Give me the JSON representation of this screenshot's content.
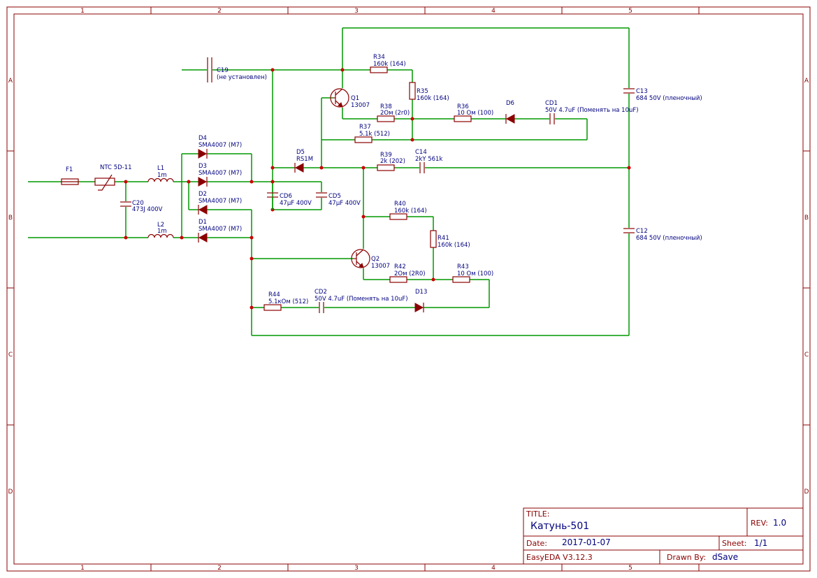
{
  "frame": {
    "columns": [
      "1",
      "2",
      "3",
      "4",
      "5"
    ],
    "rows": [
      "A",
      "B",
      "C",
      "D"
    ]
  },
  "title_block": {
    "title_label": "TITLE:",
    "title": "Катунь-501",
    "rev_label": "REV:",
    "rev": "1.0",
    "date_label": "Date:",
    "date": "2017-01-07",
    "sheet_label": "Sheet:",
    "sheet": "1/1",
    "software": "EasyEDA V3.12.3",
    "drawn_label": "Drawn By:",
    "drawn_by": "dSave"
  },
  "components": {
    "F1": {
      "ref": "F1",
      "value": ""
    },
    "NTC": {
      "ref": "NTC 5D-11",
      "value": ""
    },
    "L1": {
      "ref": "L1",
      "value": "1m"
    },
    "L2": {
      "ref": "L2",
      "value": "1m"
    },
    "C20": {
      "ref": "C20",
      "value": "473J 400V"
    },
    "D4": {
      "ref": "D4",
      "value": "SMA4007 (M7)"
    },
    "D3": {
      "ref": "D3",
      "value": "SMA4007 (M7)"
    },
    "D2": {
      "ref": "D2",
      "value": "SMA4007 (M7)"
    },
    "D1": {
      "ref": "D1",
      "value": "SMA4007 (M7)"
    },
    "CD6": {
      "ref": "CD6",
      "value": "47µF 400V"
    },
    "CD5": {
      "ref": "CD5",
      "value": "47µF 400V"
    },
    "C19": {
      "ref": "C19",
      "value": "(не установлен)"
    },
    "D5": {
      "ref": "D5",
      "value": "RS1M"
    },
    "Q1": {
      "ref": "Q1",
      "value": "13007"
    },
    "Q2": {
      "ref": "Q2",
      "value": "13007"
    },
    "R34": {
      "ref": "R34",
      "value": "160k (164)"
    },
    "R35": {
      "ref": "R35",
      "value": "160k (164)"
    },
    "R38": {
      "ref": "R38",
      "value": "2Ом (2r0)"
    },
    "R36": {
      "ref": "R36",
      "value": "10 Ом (100)"
    },
    "D6": {
      "ref": "D6",
      "value": ""
    },
    "CD1": {
      "ref": "CD1",
      "value": "50V 4.7uF (Поменять на 10uF)"
    },
    "R37": {
      "ref": "R37",
      "value": "5.1k (512)"
    },
    "R39": {
      "ref": "R39",
      "value": "2k (202)"
    },
    "C14": {
      "ref": "C14",
      "value": "2kY 561k"
    },
    "C13": {
      "ref": "C13",
      "value": "684 50V (пленочный)"
    },
    "C12": {
      "ref": "C12",
      "value": "684 50V (пленочный)"
    },
    "R40": {
      "ref": "R40",
      "value": "160k (164)"
    },
    "R41": {
      "ref": "R41",
      "value": "160k (164)"
    },
    "R42": {
      "ref": "R42",
      "value": "2Ом (2R0)"
    },
    "R43": {
      "ref": "R43",
      "value": "10 Ом (100)"
    },
    "R44": {
      "ref": "R44",
      "value": "5.1кОм (512)"
    },
    "CD2": {
      "ref": "CD2",
      "value": "50V 4.7uF (Поменять на 10uF)"
    },
    "D13": {
      "ref": "D13",
      "value": ""
    }
  },
  "colors": {
    "wire": "#009900",
    "symbol": "#8b0000",
    "label": "#000080",
    "junction": "#cc0000"
  }
}
